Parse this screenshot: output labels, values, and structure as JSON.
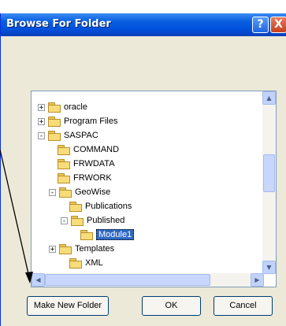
{
  "window": {
    "title": "Browse For Folder"
  },
  "title_buttons": {
    "help": "?",
    "close": "X"
  },
  "tree": [
    {
      "label": "oracle",
      "expander": "+"
    },
    {
      "label": "Program Files",
      "expander": "+"
    },
    {
      "label": "SASPAC",
      "expander": "-"
    },
    {
      "label": "COMMAND",
      "expander": ""
    },
    {
      "label": "FRWDATA",
      "expander": ""
    },
    {
      "label": "FRWORK",
      "expander": ""
    },
    {
      "label": "GeoWise",
      "expander": "-"
    },
    {
      "label": "Publications",
      "expander": ""
    },
    {
      "label": "Published",
      "expander": "-"
    },
    {
      "label": "Module1",
      "expander": "",
      "selected": true
    },
    {
      "label": "Templates",
      "expander": "+"
    },
    {
      "label": "XML",
      "expander": ""
    }
  ],
  "buttons": {
    "make_new_folder": "Make New Folder",
    "ok": "OK",
    "cancel": "Cancel"
  }
}
